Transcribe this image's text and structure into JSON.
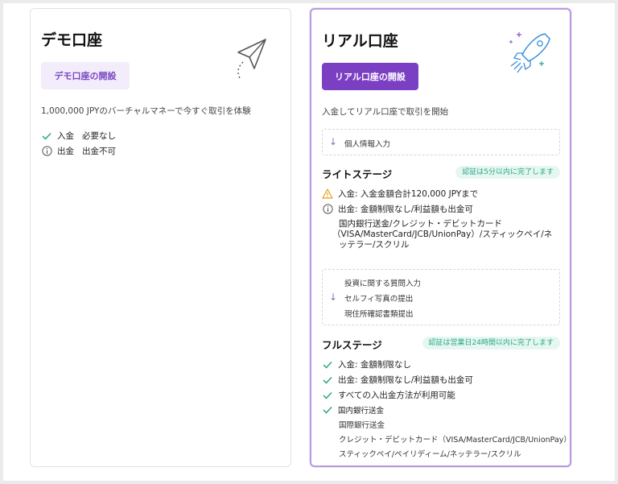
{
  "demo": {
    "title": "デモ口座",
    "button_label": "デモ口座の開設",
    "subtitle": "1,000,000 JPYのバーチャルマネーで今すぐ取引を体験",
    "deposit_label": "入金",
    "deposit_value": "必要なし",
    "withdraw_label": "出金",
    "withdraw_value": "出金不可",
    "icon": "paper-plane-icon"
  },
  "real": {
    "title": "リアル口座",
    "button_label": "リアル口座の開設",
    "subtitle": "入金してリアル口座で取引を開始",
    "icon": "rocket-icon",
    "step1": "個人情報入力",
    "lite": {
      "title": "ライトステージ",
      "badge": "認証は5分以内に完了します",
      "deposit": "入金: 入金金額合計120,000 JPYまで",
      "withdraw": "出金: 金額制限なし/利益額も出金可",
      "methods_line1": "国内銀行送金/クレジット・デビットカード",
      "methods_line2": "（VISA/MasterCard/JCB/UnionPay）/スティックペイ/ネ",
      "methods_line3": "ッテラー/スクリル"
    },
    "steps2": [
      "投資に関する質問入力",
      "セルフィ写真の提出",
      "現住所確認書類提出"
    ],
    "full": {
      "title": "フルステージ",
      "badge": "認証は営業日24時間以内に完了します",
      "deposit": "入金: 金額制限なし",
      "withdraw": "出金: 金額制限なし/利益額も出金可",
      "all_methods": "すべての入出金方法が利用可能",
      "methods": [
        "国内銀行送金",
        "国際銀行送金",
        "クレジット・デビットカード（VISA/MasterCard/JCB/UnionPay）",
        "スティックペイ/ペイリディーム/ネッテラー/スクリル"
      ]
    }
  },
  "colors": {
    "accent": "#7b3fc4",
    "check": "#2aa784",
    "warning": "#e6a11a",
    "badge_bg": "#e6f7f2"
  }
}
